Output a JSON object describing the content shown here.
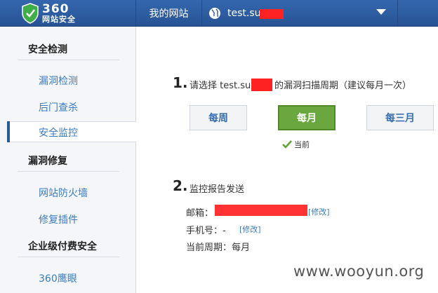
{
  "header": {
    "logo_number": "360",
    "logo_subtitle": "网站安全",
    "nav_mysite": "我的网站",
    "site_domain": "test.su        .net"
  },
  "sidebar": {
    "group1": "安全检测",
    "item_vuln_scan": "漏洞检测",
    "item_backdoor": "后门查杀",
    "item_monitor": "安全监控",
    "group2": "漏洞修复",
    "item_firewall": "网站防火墙",
    "item_plugin": "修复插件",
    "group3": "企业级付费安全",
    "item_eagle": "360鹰眼"
  },
  "step1": {
    "number": "1.",
    "text": "请选择 test.su        .net 的漏洞扫描周期（建议每月一次）",
    "options": [
      "每周",
      "每月",
      "每三月"
    ],
    "selected": "每月",
    "current_label": "当前"
  },
  "step2": {
    "number": "2.",
    "title": "监控报告发送",
    "email_label": "邮箱：",
    "modify_link": "[修改]",
    "phone_label": "手机号：-",
    "phone_modify_link": "[修改]",
    "period_label": "当前周期：每月"
  },
  "watermark": "www.wooyun.org",
  "colors": {
    "topbar": "#2b5a9b",
    "selected_button": "#6aa83f",
    "link": "#3a7bbf",
    "redaction": "#ff2222"
  }
}
